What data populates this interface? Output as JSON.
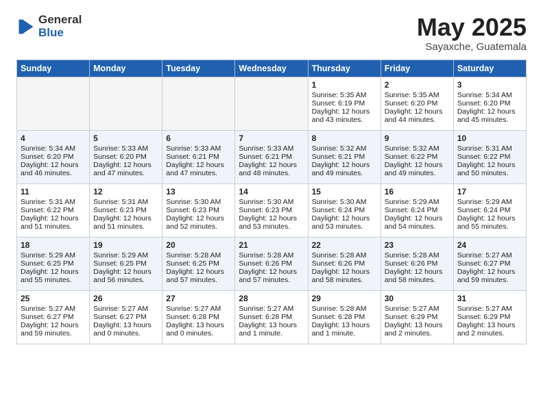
{
  "header": {
    "logo_general": "General",
    "logo_blue": "Blue",
    "month": "May 2025",
    "location": "Sayaxche, Guatemala"
  },
  "weekdays": [
    "Sunday",
    "Monday",
    "Tuesday",
    "Wednesday",
    "Thursday",
    "Friday",
    "Saturday"
  ],
  "weeks": [
    [
      {
        "day": "",
        "content": ""
      },
      {
        "day": "",
        "content": ""
      },
      {
        "day": "",
        "content": ""
      },
      {
        "day": "",
        "content": ""
      },
      {
        "day": "1",
        "content": "Sunrise: 5:35 AM\nSunset: 6:19 PM\nDaylight: 12 hours\nand 43 minutes."
      },
      {
        "day": "2",
        "content": "Sunrise: 5:35 AM\nSunset: 6:20 PM\nDaylight: 12 hours\nand 44 minutes."
      },
      {
        "day": "3",
        "content": "Sunrise: 5:34 AM\nSunset: 6:20 PM\nDaylight: 12 hours\nand 45 minutes."
      }
    ],
    [
      {
        "day": "4",
        "content": "Sunrise: 5:34 AM\nSunset: 6:20 PM\nDaylight: 12 hours\nand 46 minutes."
      },
      {
        "day": "5",
        "content": "Sunrise: 5:33 AM\nSunset: 6:20 PM\nDaylight: 12 hours\nand 47 minutes."
      },
      {
        "day": "6",
        "content": "Sunrise: 5:33 AM\nSunset: 6:21 PM\nDaylight: 12 hours\nand 47 minutes."
      },
      {
        "day": "7",
        "content": "Sunrise: 5:33 AM\nSunset: 6:21 PM\nDaylight: 12 hours\nand 48 minutes."
      },
      {
        "day": "8",
        "content": "Sunrise: 5:32 AM\nSunset: 6:21 PM\nDaylight: 12 hours\nand 49 minutes."
      },
      {
        "day": "9",
        "content": "Sunrise: 5:32 AM\nSunset: 6:22 PM\nDaylight: 12 hours\nand 49 minutes."
      },
      {
        "day": "10",
        "content": "Sunrise: 5:31 AM\nSunset: 6:22 PM\nDaylight: 12 hours\nand 50 minutes."
      }
    ],
    [
      {
        "day": "11",
        "content": "Sunrise: 5:31 AM\nSunset: 6:22 PM\nDaylight: 12 hours\nand 51 minutes."
      },
      {
        "day": "12",
        "content": "Sunrise: 5:31 AM\nSunset: 6:23 PM\nDaylight: 12 hours\nand 51 minutes."
      },
      {
        "day": "13",
        "content": "Sunrise: 5:30 AM\nSunset: 6:23 PM\nDaylight: 12 hours\nand 52 minutes."
      },
      {
        "day": "14",
        "content": "Sunrise: 5:30 AM\nSunset: 6:23 PM\nDaylight: 12 hours\nand 53 minutes."
      },
      {
        "day": "15",
        "content": "Sunrise: 5:30 AM\nSunset: 6:24 PM\nDaylight: 12 hours\nand 53 minutes."
      },
      {
        "day": "16",
        "content": "Sunrise: 5:29 AM\nSunset: 6:24 PM\nDaylight: 12 hours\nand 54 minutes."
      },
      {
        "day": "17",
        "content": "Sunrise: 5:29 AM\nSunset: 6:24 PM\nDaylight: 12 hours\nand 55 minutes."
      }
    ],
    [
      {
        "day": "18",
        "content": "Sunrise: 5:29 AM\nSunset: 6:25 PM\nDaylight: 12 hours\nand 55 minutes."
      },
      {
        "day": "19",
        "content": "Sunrise: 5:29 AM\nSunset: 6:25 PM\nDaylight: 12 hours\nand 56 minutes."
      },
      {
        "day": "20",
        "content": "Sunrise: 5:28 AM\nSunset: 6:25 PM\nDaylight: 12 hours\nand 57 minutes."
      },
      {
        "day": "21",
        "content": "Sunrise: 5:28 AM\nSunset: 6:26 PM\nDaylight: 12 hours\nand 57 minutes."
      },
      {
        "day": "22",
        "content": "Sunrise: 5:28 AM\nSunset: 6:26 PM\nDaylight: 12 hours\nand 58 minutes."
      },
      {
        "day": "23",
        "content": "Sunrise: 5:28 AM\nSunset: 6:26 PM\nDaylight: 12 hours\nand 58 minutes."
      },
      {
        "day": "24",
        "content": "Sunrise: 5:27 AM\nSunset: 6:27 PM\nDaylight: 12 hours\nand 59 minutes."
      }
    ],
    [
      {
        "day": "25",
        "content": "Sunrise: 5:27 AM\nSunset: 6:27 PM\nDaylight: 12 hours\nand 59 minutes."
      },
      {
        "day": "26",
        "content": "Sunrise: 5:27 AM\nSunset: 6:27 PM\nDaylight: 13 hours\nand 0 minutes."
      },
      {
        "day": "27",
        "content": "Sunrise: 5:27 AM\nSunset: 6:28 PM\nDaylight: 13 hours\nand 0 minutes."
      },
      {
        "day": "28",
        "content": "Sunrise: 5:27 AM\nSunset: 6:28 PM\nDaylight: 13 hours\nand 1 minute."
      },
      {
        "day": "29",
        "content": "Sunrise: 5:28 AM\nSunset: 6:28 PM\nDaylight: 13 hours\nand 1 minute."
      },
      {
        "day": "30",
        "content": "Sunrise: 5:27 AM\nSunset: 6:29 PM\nDaylight: 13 hours\nand 2 minutes."
      },
      {
        "day": "31",
        "content": "Sunrise: 5:27 AM\nSunset: 6:29 PM\nDaylight: 13 hours\nand 2 minutes."
      }
    ]
  ]
}
